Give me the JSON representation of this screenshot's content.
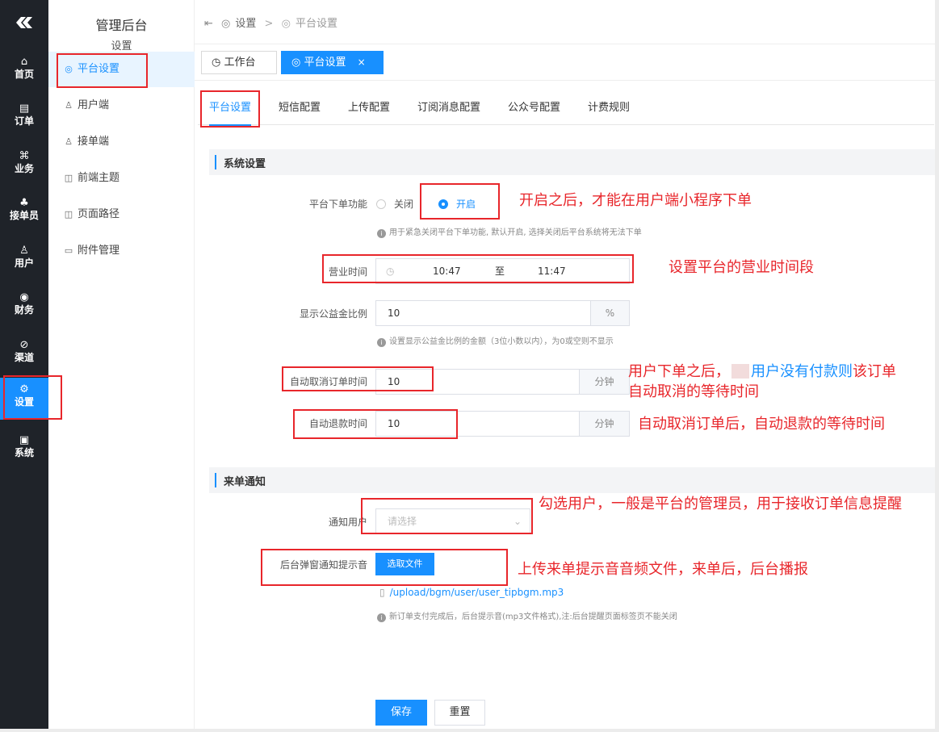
{
  "rail": {
    "logo_icon": "double-chevron-logo",
    "items": [
      {
        "label": "首页",
        "icon": "⌂"
      },
      {
        "label": "订单",
        "icon": "▤"
      },
      {
        "label": "业务",
        "icon": "⌘"
      },
      {
        "label": "接单员",
        "icon": "♣"
      },
      {
        "label": "用户",
        "icon": "♙"
      },
      {
        "label": "财务",
        "icon": "◉"
      },
      {
        "label": "渠道",
        "icon": "⊘"
      },
      {
        "label": "设置",
        "icon": "⚙"
      },
      {
        "label": "系统",
        "icon": "▣"
      }
    ],
    "active_index": 7
  },
  "sidebar": {
    "app_title": "管理后台",
    "section_title": "设置",
    "items": [
      {
        "label": "平台设置",
        "icon": "◎"
      },
      {
        "label": "用户端",
        "icon": "♙"
      },
      {
        "label": "接单端",
        "icon": "♙"
      },
      {
        "label": "前端主题",
        "icon": "◫"
      },
      {
        "label": "页面路径",
        "icon": "◫"
      },
      {
        "label": "附件管理",
        "icon": "▭"
      }
    ]
  },
  "breadcrumb": {
    "collapse_icon": "⇤",
    "items": [
      "设置",
      "平台设置"
    ],
    "separator": ">"
  },
  "tags": [
    {
      "label": "工作台",
      "icon": "◷"
    },
    {
      "label": "平台设置",
      "icon": "◎",
      "close": "×"
    }
  ],
  "tabs": [
    "平台设置",
    "短信配置",
    "上传配置",
    "订阅消息配置",
    "公众号配置",
    "计费规则"
  ],
  "system_section": {
    "title": "系统设置",
    "order_switch": {
      "label": "平台下单功能",
      "off": "关闭",
      "on": "开启",
      "selected": "开启",
      "hint": "用于紧急关闭平台下单功能, 默认开启, 选择关闭后平台系统将无法下单"
    },
    "business_hours": {
      "label": "营业时间",
      "start": "10:47",
      "sep": "至",
      "end": "11:47"
    },
    "charity": {
      "label": "显示公益金比例",
      "value": "10",
      "unit": "%",
      "hint": "设置显示公益金比例的金额（3位小数以内），为0或空则不显示"
    },
    "auto_cancel": {
      "label": "自动取消订单时间",
      "value": "10",
      "unit": "分钟"
    },
    "auto_refund": {
      "label": "自动退款时间",
      "value": "10",
      "unit": "分钟"
    }
  },
  "notice_section": {
    "title": "来单通知",
    "notify_user": {
      "label": "通知用户",
      "placeholder": "请选择"
    },
    "sound": {
      "label": "后台弹窗通知提示音",
      "button": "选取文件",
      "file": "/upload/bgm/user/user_tipbgm.mp3",
      "hint": "新订单支付完成后，后台提示音(mp3文件格式),注:后台提醒页面标签页不能关闭"
    }
  },
  "actions": {
    "save": "保存",
    "reset": "重置"
  },
  "annotations": {
    "open": "开启之后，才能在用户端小程序下单",
    "hours": "设置平台的营业时间段",
    "cancel_a": "用户下单之后，",
    "cancel_b": "用户没有付款则",
    "cancel_c": "该订单",
    "cancel_d": "自动取消的等待时间",
    "refund": "自动取消订单后，自动退款的等待时间",
    "notify": "勾选用户，一般是平台的管理员，用于接收订单信息提醒",
    "sound": "上传来单提示音音频文件，来单后，后台播报"
  },
  "colors": {
    "accent": "#1890ff",
    "annotation": "#e8262b",
    "rail_bg": "#1f2329"
  }
}
